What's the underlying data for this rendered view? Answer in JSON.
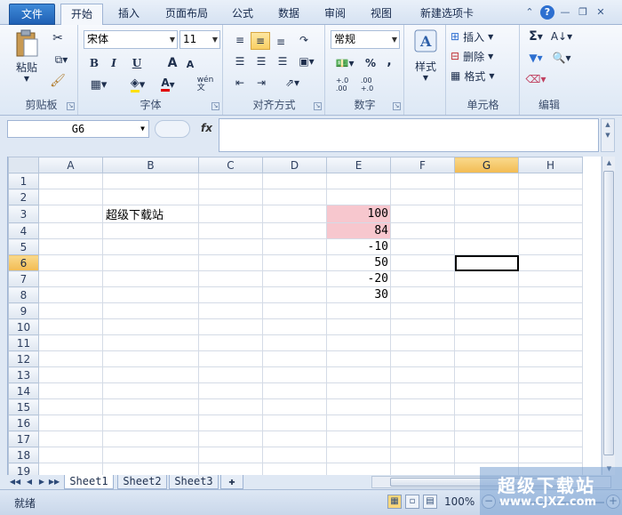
{
  "tabs": [
    {
      "label": "文件"
    },
    {
      "label": "开始"
    },
    {
      "label": "插入"
    },
    {
      "label": "页面布局"
    },
    {
      "label": "公式"
    },
    {
      "label": "数据"
    },
    {
      "label": "审阅"
    },
    {
      "label": "视图"
    },
    {
      "label": "新建选项卡"
    }
  ],
  "ribbon": {
    "clipboard": {
      "paste": "粘贴",
      "label": "剪贴板"
    },
    "font": {
      "name": "宋体",
      "size": "11",
      "bold": "B",
      "italic": "I",
      "underline": "U",
      "grow": "A",
      "shrink": "A",
      "font_color_glyph": "A",
      "wen": "wén\n文",
      "label": "字体"
    },
    "alignment": {
      "label": "对齐方式"
    },
    "number": {
      "format": "常规",
      "percent": "%",
      "comma": ",",
      "inc": "+.0\n.00",
      "dec": ".00\n+.0",
      "label": "数字"
    },
    "styles": {
      "label": "样式"
    },
    "cells": {
      "insert": "插入",
      "delete": "删除",
      "format": "格式",
      "label": "单元格"
    },
    "editing": {
      "sum": "Σ",
      "label": "编辑"
    }
  },
  "formula_bar": {
    "name_box": "G6",
    "fx": "fx",
    "formula": ""
  },
  "columns": [
    "A",
    "B",
    "C",
    "D",
    "E",
    "F",
    "G",
    "H"
  ],
  "selected_column": "G",
  "selected_row": "6",
  "rows": [
    {
      "n": "1",
      "B": "",
      "E": ""
    },
    {
      "n": "2",
      "B": "",
      "E": ""
    },
    {
      "n": "3",
      "B": "超级下载站",
      "E": "100"
    },
    {
      "n": "4",
      "B": "",
      "E": "84"
    },
    {
      "n": "5",
      "B": "",
      "E": "-10"
    },
    {
      "n": "6",
      "B": "",
      "E": "50"
    },
    {
      "n": "7",
      "B": "",
      "E": "-20"
    },
    {
      "n": "8",
      "B": "",
      "E": "30"
    },
    {
      "n": "9",
      "B": "",
      "E": ""
    },
    {
      "n": "10",
      "B": "",
      "E": ""
    },
    {
      "n": "11",
      "B": "",
      "E": ""
    },
    {
      "n": "12",
      "B": "",
      "E": ""
    },
    {
      "n": "13",
      "B": "",
      "E": ""
    },
    {
      "n": "14",
      "B": "",
      "E": ""
    },
    {
      "n": "15",
      "B": "",
      "E": ""
    },
    {
      "n": "16",
      "B": "",
      "E": ""
    },
    {
      "n": "17",
      "B": "",
      "E": ""
    },
    {
      "n": "18",
      "B": "",
      "E": ""
    },
    {
      "n": "19",
      "B": "",
      "E": ""
    }
  ],
  "highlight_color": "#f7c7ce",
  "sheets": [
    {
      "label": "Sheet1"
    },
    {
      "label": "Sheet2"
    },
    {
      "label": "Sheet3"
    }
  ],
  "status": {
    "ready": "就绪",
    "zoom": "100%"
  },
  "watermark": {
    "title": "超级下载站",
    "url": "www.CJXZ.com"
  }
}
